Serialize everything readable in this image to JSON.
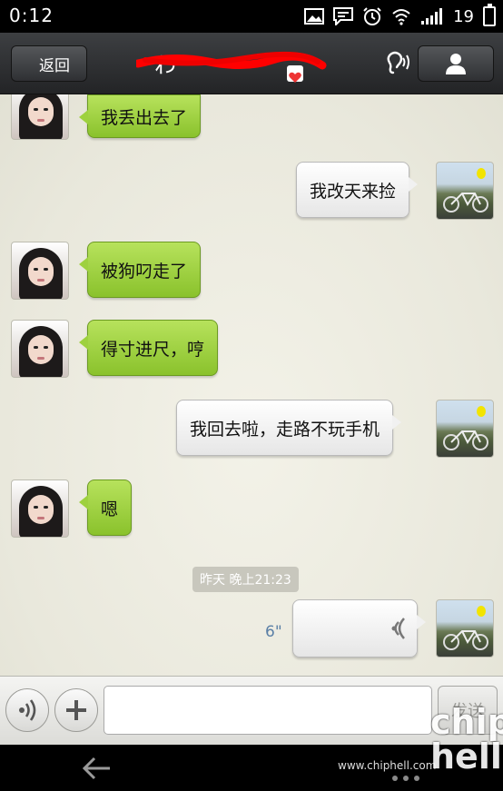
{
  "status_bar": {
    "time": "0:12",
    "battery_level": "19",
    "icons": [
      "gallery-icon",
      "message-icon",
      "alarm-icon",
      "wifi-icon",
      "signal-icon",
      "battery-icon"
    ]
  },
  "title_bar": {
    "back_label": "返回",
    "title": "わ一",
    "icons": [
      "ear-icon",
      "profile-icon"
    ]
  },
  "messages": [
    {
      "side": "left",
      "text": "我丢出去了"
    },
    {
      "side": "right",
      "text": "我改天来捡"
    },
    {
      "side": "left",
      "text": "被狗叼走了"
    },
    {
      "side": "left",
      "text": "得寸进尺，哼"
    },
    {
      "side": "right",
      "text": "我回去啦，走路不玩手机"
    },
    {
      "side": "left",
      "text": "嗯"
    }
  ],
  "timestamp": "昨天 晚上21:23",
  "voice_message": {
    "side": "right",
    "duration": "6\""
  },
  "input_bar": {
    "value": "",
    "send_label": "发送",
    "icons": [
      "voice-icon",
      "plus-icon"
    ]
  },
  "nav_bar": {
    "watermark_url": "www.chiphell.com",
    "watermark_logo": "chip hell",
    "icons": [
      "back-arrow-icon",
      "menu-dots-icon"
    ]
  },
  "colors": {
    "green_bubble": "#9ed13f",
    "white_bubble": "#f1f1f1",
    "chat_background": "#ecebdf",
    "voice_duration": "#5a7fa6"
  }
}
